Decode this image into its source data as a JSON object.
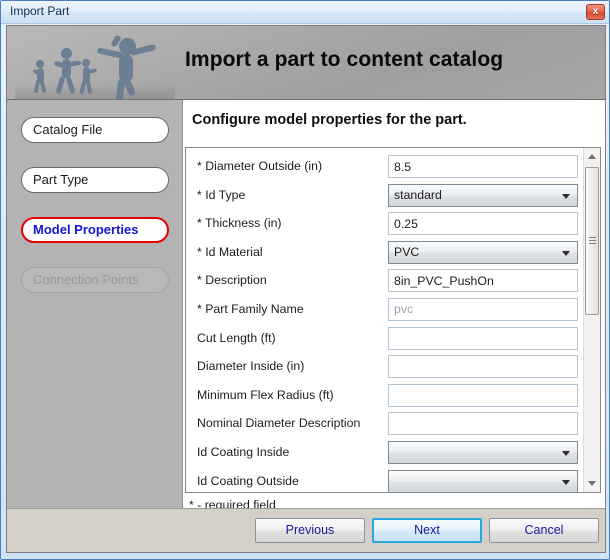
{
  "window": {
    "title": "Import Part",
    "close_label": "x"
  },
  "banner": {
    "title": "Import a part to content catalog"
  },
  "sidebar": {
    "items": [
      {
        "label": "Catalog File",
        "state": "normal"
      },
      {
        "label": "Part Type",
        "state": "normal"
      },
      {
        "label": "Model Properties",
        "state": "active"
      },
      {
        "label": "Connection Points",
        "state": "disabled"
      }
    ]
  },
  "pane": {
    "heading": "Configure model properties for the part.",
    "required_note": "* - required field",
    "fields": [
      {
        "label": "* Diameter Outside (in)",
        "type": "text",
        "value": "8.5",
        "placeholder": ""
      },
      {
        "label": "* Id Type",
        "type": "select",
        "value": "standard"
      },
      {
        "label": "* Thickness (in)",
        "type": "text",
        "value": "0.25",
        "placeholder": ""
      },
      {
        "label": "* Id Material",
        "type": "select",
        "value": "PVC"
      },
      {
        "label": "* Description",
        "type": "text",
        "value": "8in_PVC_PushOn",
        "placeholder": ""
      },
      {
        "label": "* Part Family Name",
        "type": "text",
        "value": "",
        "placeholder": "pvc"
      },
      {
        "label": "Cut Length (ft)",
        "type": "text",
        "value": "",
        "placeholder": ""
      },
      {
        "label": "Diameter Inside (in)",
        "type": "text",
        "value": "",
        "placeholder": ""
      },
      {
        "label": "Minimum Flex Radius (ft)",
        "type": "text",
        "value": "",
        "placeholder": ""
      },
      {
        "label": "Nominal Diameter Description",
        "type": "text",
        "value": "",
        "placeholder": ""
      },
      {
        "label": "Id Coating Inside",
        "type": "select",
        "value": ""
      },
      {
        "label": "Id Coating Outside",
        "type": "select",
        "value": ""
      }
    ]
  },
  "footer": {
    "previous_label": "Previous",
    "next_label": "Next",
    "cancel_label": "Cancel"
  },
  "colors": {
    "active_nav_border": "#e60000",
    "active_nav_text": "#1515cf",
    "button_text": "#18189c",
    "primary_focus": "#29a8e0",
    "banner_bg": "#aaaaaa",
    "sidebar_bg": "#b3b3b3",
    "close_btn": "#d9452c"
  }
}
